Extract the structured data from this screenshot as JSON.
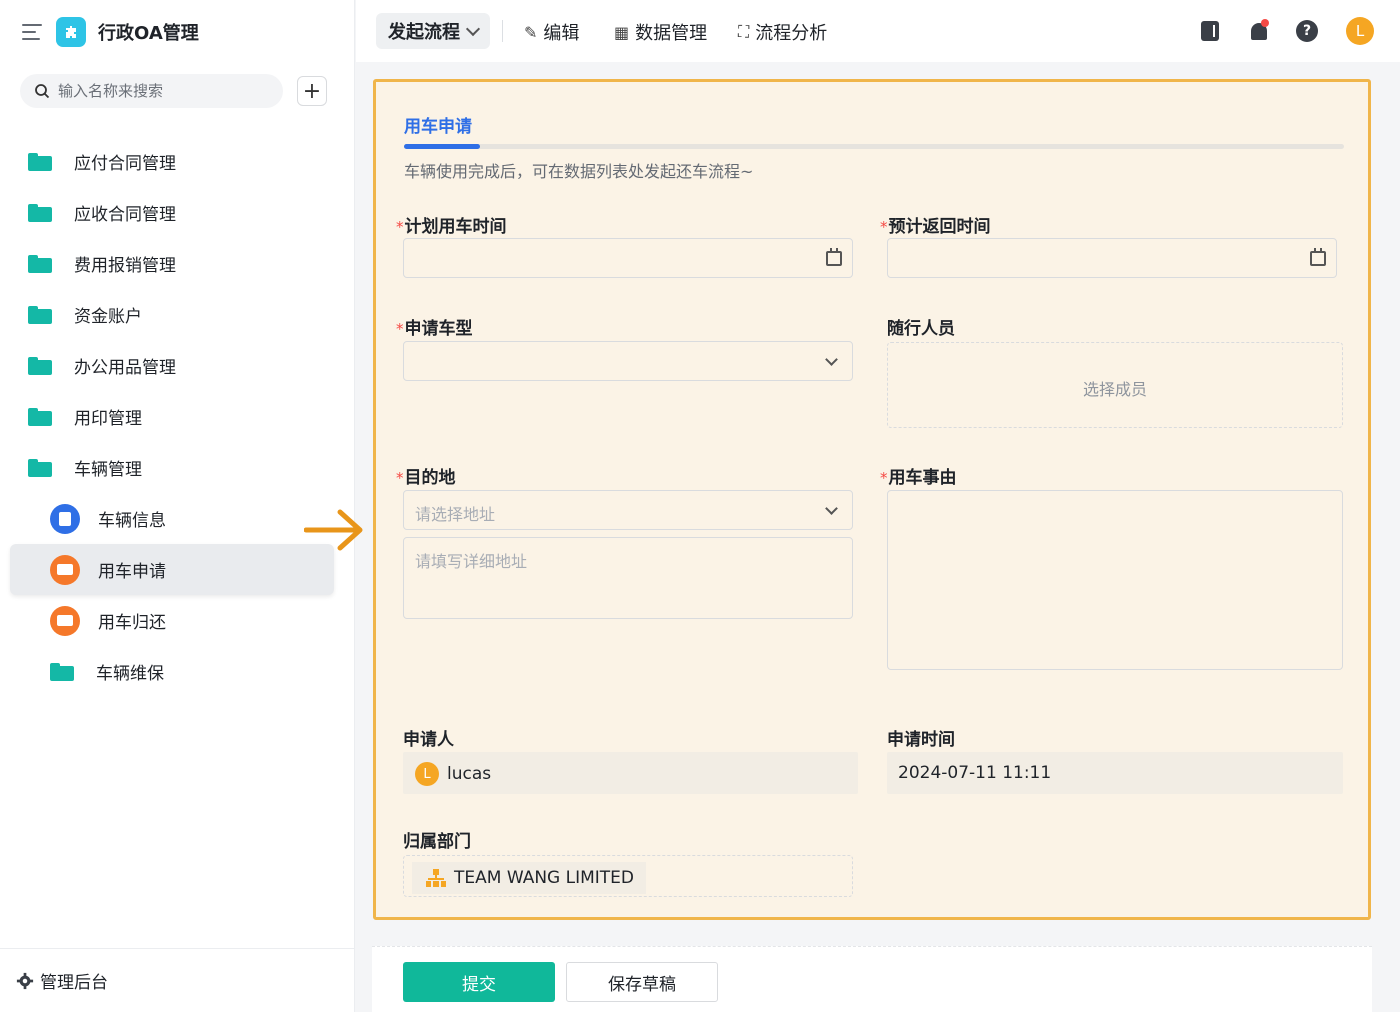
{
  "app": {
    "title": "行政OA管理"
  },
  "sidebar": {
    "search_placeholder": "输入名称来搜索",
    "items": [
      {
        "label": "应付合同管理",
        "icon": "folder-icon"
      },
      {
        "label": "应收合同管理",
        "icon": "folder-icon"
      },
      {
        "label": "费用报销管理",
        "icon": "folder-icon"
      },
      {
        "label": "资金账户",
        "icon": "folder-icon"
      },
      {
        "label": "办公用品管理",
        "icon": "folder-icon"
      },
      {
        "label": "用印管理",
        "icon": "folder-icon"
      },
      {
        "label": "车辆管理",
        "icon": "folder-open-icon"
      },
      {
        "label": "车辆信息",
        "icon": "document-icon"
      },
      {
        "label": "用车申请",
        "icon": "truck-icon",
        "active": true
      },
      {
        "label": "用车归还",
        "icon": "truck-icon"
      },
      {
        "label": "车辆维保",
        "icon": "folder-icon"
      }
    ],
    "footer_label": "管理后台"
  },
  "topbar": {
    "flow_button": "发起流程",
    "edit": "编辑",
    "data_manage": "数据管理",
    "flow_analysis": "流程分析",
    "avatar_letter": "L"
  },
  "form": {
    "tab": "用车申请",
    "description": "车辆使用完成后，可在数据列表处发起还车流程~",
    "fields": {
      "plan_time": {
        "label": "计划用车时间",
        "required": true
      },
      "return_time": {
        "label": "预计返回时间",
        "required": true
      },
      "car_type": {
        "label": "申请车型",
        "required": true
      },
      "companions": {
        "label": "随行人员",
        "placeholder": "选择成员"
      },
      "destination": {
        "label": "目的地",
        "required": true,
        "select_placeholder": "请选择地址",
        "detail_placeholder": "请填写详细地址"
      },
      "reason": {
        "label": "用车事由",
        "required": true
      },
      "applicant": {
        "label": "申请人",
        "value": "lucas",
        "avatar_letter": "L"
      },
      "apply_time": {
        "label": "申请时间",
        "value": "2024-07-11 11:11"
      },
      "department": {
        "label": "归属部门",
        "value": "TEAM WANG LIMITED"
      }
    },
    "required_mark": "*"
  },
  "actions": {
    "submit": "提交",
    "save_draft": "保存草稿"
  },
  "colors": {
    "accent": "#2f6fe6",
    "primary_button": "#10b89a",
    "folder": "#14b8a6",
    "highlight_border": "#f0b54a"
  }
}
